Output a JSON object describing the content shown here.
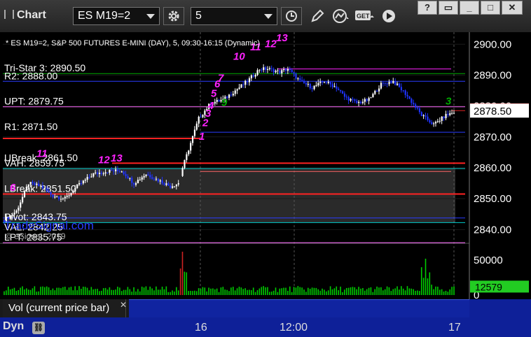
{
  "window": {
    "title": "Chart",
    "buttons": [
      "?",
      "▭",
      "_",
      "□",
      "✕"
    ]
  },
  "toolbar": {
    "symbol": "ES M19=2",
    "interval": "5"
  },
  "chart_header": "* ES M19=2, S&P 500 FUTURES E-MINI (DAY), 5, 09:30-16:15 (Dynamic)",
  "watermark": "TradeSignal.com",
  "copyright": "© eSignal, 2019",
  "colors": {
    "up_candle": "#ffffff",
    "down_candle": "#1f33ff",
    "count_magenta": "#ff22ff",
    "count_green": "#00aa00",
    "volume": "#00cc00",
    "panel_bg": "#1024a0"
  },
  "chart_data": {
    "type": "candlestick",
    "symbol": "ES M19=2",
    "interval_minutes": 5,
    "price_axis": {
      "ylim": [
        2836,
        2903
      ],
      "ticks": [
        "2900.00",
        "2890.00",
        "2880.00",
        "2870.00",
        "2860.00",
        "2850.00",
        "2840.00"
      ]
    },
    "last_price": "2878.50",
    "level_markers": [
      "2878.50"
    ],
    "levels": [
      {
        "label": "Tri-Star 3: 2890.50",
        "value": 2890.5,
        "color": "#00aa00"
      },
      {
        "label": "",
        "value": 2892.0,
        "color": "#ff22ff"
      },
      {
        "label": "R2: 2888.00",
        "value": 2888.0,
        "color": "#2a3cff"
      },
      {
        "label": "UPT: 2879.75",
        "value": 2879.75,
        "color": "#ff66ff"
      },
      {
        "label": "",
        "value": 2878.5,
        "color": "#dd2222"
      },
      {
        "label": "R1: 2871.50",
        "value": 2871.5,
        "color": "#2a3cff"
      },
      {
        "label": "",
        "value": 2869.5,
        "color": "#ff2222"
      },
      {
        "label": "UBreak: 2861.50",
        "value": 2861.5,
        "color": "#ff2222"
      },
      {
        "label": "VAH: 2859.75",
        "value": 2859.75,
        "color": "#00cccc"
      },
      {
        "label": "",
        "value": 2858.8,
        "color": "#ff6666"
      },
      {
        "label": "LBreak: 2851.50",
        "value": 2851.5,
        "color": "#ff2222"
      },
      {
        "label": "Pivot: 2843.75",
        "value": 2843.75,
        "color": "#2a3cff"
      },
      {
        "label": "VAL: 2842.25",
        "value": 2842.25,
        "color": "#00cccc"
      },
      {
        "label": "LPT: 2835.75",
        "value": 2835.75,
        "color": "#ff66ff"
      }
    ],
    "value_area": [
      2842.25,
      2859.75
    ],
    "count_labels": [
      {
        "text": "11",
        "color": "#ff22ff"
      },
      {
        "text": "12",
        "color": "#ff22ff"
      },
      {
        "text": "13",
        "color": "#ff22ff"
      },
      {
        "text": "6",
        "color": "#ff22ff"
      },
      {
        "text": "1",
        "color": "#ff22ff"
      },
      {
        "text": "2",
        "color": "#ff22ff"
      },
      {
        "text": "3",
        "color": "#ff22ff"
      },
      {
        "text": "4",
        "color": "#ff22ff"
      },
      {
        "text": "5",
        "color": "#ff22ff"
      },
      {
        "text": "6",
        "color": "#ff22ff"
      },
      {
        "text": "7",
        "color": "#ff22ff"
      },
      {
        "text": "9",
        "color": "#00aa00"
      },
      {
        "text": "10",
        "color": "#ff22ff"
      },
      {
        "text": "11",
        "color": "#ff22ff"
      },
      {
        "text": "12",
        "color": "#ff22ff"
      },
      {
        "text": "13",
        "color": "#ff22ff"
      },
      {
        "text": "3",
        "color": "#00aa00"
      }
    ],
    "volume_axis": {
      "ylim": [
        0,
        70000
      ],
      "ticks": [
        "50000",
        "0"
      ]
    },
    "volume_last": "12579",
    "x_ticks": [
      "16",
      "12:00",
      "17"
    ],
    "pane_label": "Vol (current price bar)"
  },
  "status": {
    "label": "Dyn"
  }
}
